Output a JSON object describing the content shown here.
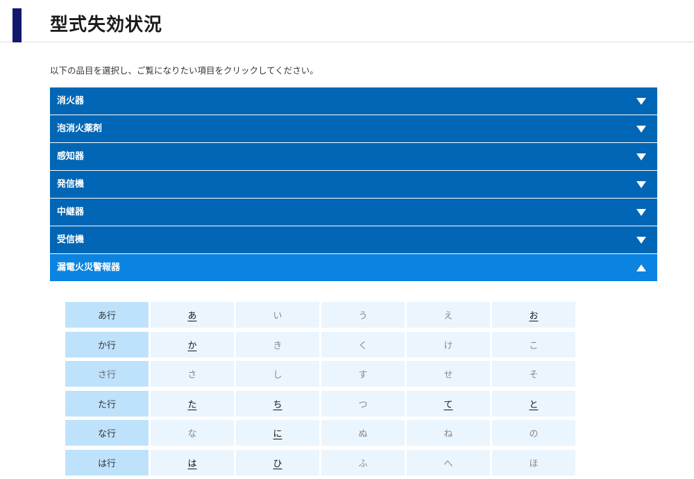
{
  "page": {
    "title": "型式失効状況",
    "instruction": "以下の品目を選択し、ご覧になりたい項目をクリックしてください。"
  },
  "accordion": {
    "items": [
      {
        "label": "消火器",
        "open": false
      },
      {
        "label": "泡消火薬剤",
        "open": false
      },
      {
        "label": "感知器",
        "open": false
      },
      {
        "label": "発信機",
        "open": false
      },
      {
        "label": "中継器",
        "open": false
      },
      {
        "label": "受信機",
        "open": false
      },
      {
        "label": "漏電火災警報器",
        "open": true
      }
    ]
  },
  "kana_table": {
    "rows": [
      {
        "head": "あ行",
        "head_active": true,
        "cells": [
          {
            "k": "あ",
            "active": true
          },
          {
            "k": "い",
            "active": false
          },
          {
            "k": "う",
            "active": false
          },
          {
            "k": "え",
            "active": false
          },
          {
            "k": "お",
            "active": true
          }
        ]
      },
      {
        "head": "か行",
        "head_active": true,
        "cells": [
          {
            "k": "か",
            "active": true
          },
          {
            "k": "き",
            "active": false
          },
          {
            "k": "く",
            "active": false
          },
          {
            "k": "け",
            "active": false
          },
          {
            "k": "こ",
            "active": false
          }
        ]
      },
      {
        "head": "さ行",
        "head_active": false,
        "cells": [
          {
            "k": "さ",
            "active": false
          },
          {
            "k": "し",
            "active": false
          },
          {
            "k": "す",
            "active": false
          },
          {
            "k": "せ",
            "active": false
          },
          {
            "k": "そ",
            "active": false
          }
        ]
      },
      {
        "head": "た行",
        "head_active": true,
        "cells": [
          {
            "k": "た",
            "active": true
          },
          {
            "k": "ち",
            "active": true
          },
          {
            "k": "つ",
            "active": false
          },
          {
            "k": "て",
            "active": true
          },
          {
            "k": "と",
            "active": true
          }
        ]
      },
      {
        "head": "な行",
        "head_active": true,
        "cells": [
          {
            "k": "な",
            "active": false
          },
          {
            "k": "に",
            "active": true
          },
          {
            "k": "ぬ",
            "active": false
          },
          {
            "k": "ね",
            "active": false
          },
          {
            "k": "の",
            "active": false
          }
        ]
      },
      {
        "head": "は行",
        "head_active": true,
        "cells": [
          {
            "k": "は",
            "active": true
          },
          {
            "k": "ひ",
            "active": true
          },
          {
            "k": "ふ",
            "active": false
          },
          {
            "k": "へ",
            "active": false
          },
          {
            "k": "ほ",
            "active": false
          }
        ]
      }
    ]
  },
  "colors": {
    "accordion_bg": "#0066b5",
    "accordion_open_bg": "#0a84e0",
    "header_bar": "#10196e",
    "kana_head_bg": "#bee2fc",
    "kana_cell_bg": "#eaf5fe"
  },
  "icons": {
    "collapsed": "chevron-down-icon",
    "expanded": "chevron-up-icon"
  }
}
